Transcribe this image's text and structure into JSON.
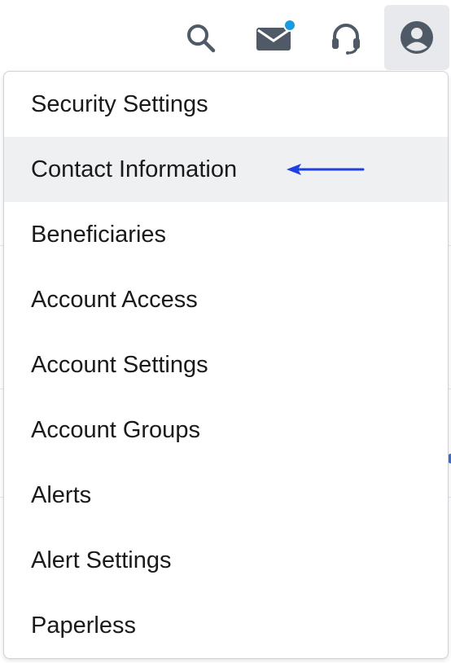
{
  "topbar": {
    "icons": [
      {
        "name": "search-icon"
      },
      {
        "name": "mail-icon",
        "has_notification": true
      },
      {
        "name": "headset-icon"
      },
      {
        "name": "user-profile-icon",
        "active": true
      }
    ],
    "notification_color": "#1a9be0"
  },
  "menu": {
    "items": [
      {
        "label": "Security Settings"
      },
      {
        "label": "Contact Information",
        "highlighted": true
      },
      {
        "label": "Beneficiaries"
      },
      {
        "label": "Account Access"
      },
      {
        "label": "Account Settings"
      },
      {
        "label": "Account Groups"
      },
      {
        "label": "Alerts"
      },
      {
        "label": "Alert Settings"
      },
      {
        "label": "Paperless"
      }
    ]
  },
  "annotation": {
    "icon": "left-arrow-icon",
    "color": "#1f3fe0"
  }
}
